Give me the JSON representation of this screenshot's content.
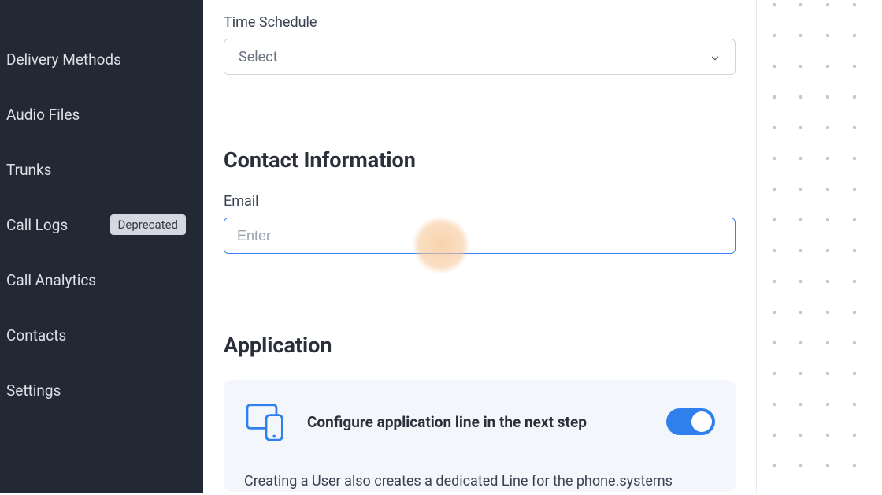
{
  "sidebar": {
    "items": [
      {
        "label": "Delivery Methods"
      },
      {
        "label": "Audio Files"
      },
      {
        "label": "Trunks"
      },
      {
        "label": "Call Logs",
        "badge": "Deprecated"
      },
      {
        "label": "Call Analytics"
      },
      {
        "label": "Contacts"
      },
      {
        "label": "Settings"
      }
    ]
  },
  "form": {
    "time_schedule": {
      "label": "Time Schedule",
      "placeholder": "Select"
    },
    "contact_info_title": "Contact Information",
    "email": {
      "label": "Email",
      "placeholder": "Enter",
      "value": ""
    },
    "application_title": "Application",
    "app_card": {
      "title": "Configure application line in the next step",
      "toggle_on": true,
      "description": "Creating a User also creates a dedicated Line for the phone.systems"
    }
  }
}
